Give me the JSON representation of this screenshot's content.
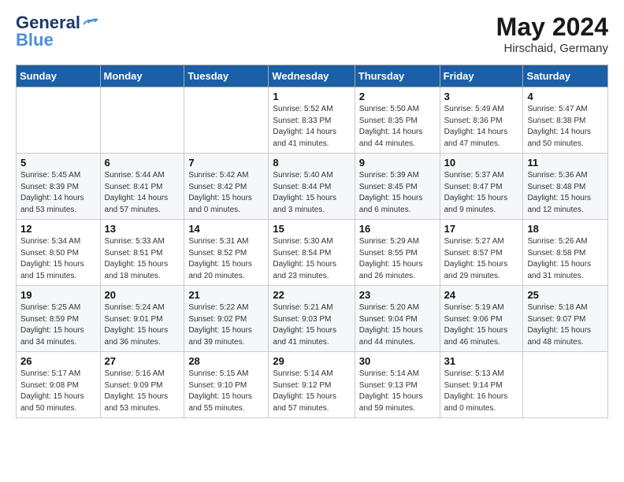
{
  "header": {
    "logo_line1": "General",
    "logo_line2": "Blue",
    "month": "May 2024",
    "location": "Hirschaid, Germany"
  },
  "weekdays": [
    "Sunday",
    "Monday",
    "Tuesday",
    "Wednesday",
    "Thursday",
    "Friday",
    "Saturday"
  ],
  "weeks": [
    [
      {
        "day": "",
        "info": ""
      },
      {
        "day": "",
        "info": ""
      },
      {
        "day": "",
        "info": ""
      },
      {
        "day": "1",
        "info": "Sunrise: 5:52 AM\nSunset: 8:33 PM\nDaylight: 14 hours\nand 41 minutes."
      },
      {
        "day": "2",
        "info": "Sunrise: 5:50 AM\nSunset: 8:35 PM\nDaylight: 14 hours\nand 44 minutes."
      },
      {
        "day": "3",
        "info": "Sunrise: 5:49 AM\nSunset: 8:36 PM\nDaylight: 14 hours\nand 47 minutes."
      },
      {
        "day": "4",
        "info": "Sunrise: 5:47 AM\nSunset: 8:38 PM\nDaylight: 14 hours\nand 50 minutes."
      }
    ],
    [
      {
        "day": "5",
        "info": "Sunrise: 5:45 AM\nSunset: 8:39 PM\nDaylight: 14 hours\nand 53 minutes."
      },
      {
        "day": "6",
        "info": "Sunrise: 5:44 AM\nSunset: 8:41 PM\nDaylight: 14 hours\nand 57 minutes."
      },
      {
        "day": "7",
        "info": "Sunrise: 5:42 AM\nSunset: 8:42 PM\nDaylight: 15 hours\nand 0 minutes."
      },
      {
        "day": "8",
        "info": "Sunrise: 5:40 AM\nSunset: 8:44 PM\nDaylight: 15 hours\nand 3 minutes."
      },
      {
        "day": "9",
        "info": "Sunrise: 5:39 AM\nSunset: 8:45 PM\nDaylight: 15 hours\nand 6 minutes."
      },
      {
        "day": "10",
        "info": "Sunrise: 5:37 AM\nSunset: 8:47 PM\nDaylight: 15 hours\nand 9 minutes."
      },
      {
        "day": "11",
        "info": "Sunrise: 5:36 AM\nSunset: 8:48 PM\nDaylight: 15 hours\nand 12 minutes."
      }
    ],
    [
      {
        "day": "12",
        "info": "Sunrise: 5:34 AM\nSunset: 8:50 PM\nDaylight: 15 hours\nand 15 minutes."
      },
      {
        "day": "13",
        "info": "Sunrise: 5:33 AM\nSunset: 8:51 PM\nDaylight: 15 hours\nand 18 minutes."
      },
      {
        "day": "14",
        "info": "Sunrise: 5:31 AM\nSunset: 8:52 PM\nDaylight: 15 hours\nand 20 minutes."
      },
      {
        "day": "15",
        "info": "Sunrise: 5:30 AM\nSunset: 8:54 PM\nDaylight: 15 hours\nand 23 minutes."
      },
      {
        "day": "16",
        "info": "Sunrise: 5:29 AM\nSunset: 8:55 PM\nDaylight: 15 hours\nand 26 minutes."
      },
      {
        "day": "17",
        "info": "Sunrise: 5:27 AM\nSunset: 8:57 PM\nDaylight: 15 hours\nand 29 minutes."
      },
      {
        "day": "18",
        "info": "Sunrise: 5:26 AM\nSunset: 8:58 PM\nDaylight: 15 hours\nand 31 minutes."
      }
    ],
    [
      {
        "day": "19",
        "info": "Sunrise: 5:25 AM\nSunset: 8:59 PM\nDaylight: 15 hours\nand 34 minutes."
      },
      {
        "day": "20",
        "info": "Sunrise: 5:24 AM\nSunset: 9:01 PM\nDaylight: 15 hours\nand 36 minutes."
      },
      {
        "day": "21",
        "info": "Sunrise: 5:22 AM\nSunset: 9:02 PM\nDaylight: 15 hours\nand 39 minutes."
      },
      {
        "day": "22",
        "info": "Sunrise: 5:21 AM\nSunset: 9:03 PM\nDaylight: 15 hours\nand 41 minutes."
      },
      {
        "day": "23",
        "info": "Sunrise: 5:20 AM\nSunset: 9:04 PM\nDaylight: 15 hours\nand 44 minutes."
      },
      {
        "day": "24",
        "info": "Sunrise: 5:19 AM\nSunset: 9:06 PM\nDaylight: 15 hours\nand 46 minutes."
      },
      {
        "day": "25",
        "info": "Sunrise: 5:18 AM\nSunset: 9:07 PM\nDaylight: 15 hours\nand 48 minutes."
      }
    ],
    [
      {
        "day": "26",
        "info": "Sunrise: 5:17 AM\nSunset: 9:08 PM\nDaylight: 15 hours\nand 50 minutes."
      },
      {
        "day": "27",
        "info": "Sunrise: 5:16 AM\nSunset: 9:09 PM\nDaylight: 15 hours\nand 53 minutes."
      },
      {
        "day": "28",
        "info": "Sunrise: 5:15 AM\nSunset: 9:10 PM\nDaylight: 15 hours\nand 55 minutes."
      },
      {
        "day": "29",
        "info": "Sunrise: 5:14 AM\nSunset: 9:12 PM\nDaylight: 15 hours\nand 57 minutes."
      },
      {
        "day": "30",
        "info": "Sunrise: 5:14 AM\nSunset: 9:13 PM\nDaylight: 15 hours\nand 59 minutes."
      },
      {
        "day": "31",
        "info": "Sunrise: 5:13 AM\nSunset: 9:14 PM\nDaylight: 16 hours\nand 0 minutes."
      },
      {
        "day": "",
        "info": ""
      }
    ]
  ]
}
